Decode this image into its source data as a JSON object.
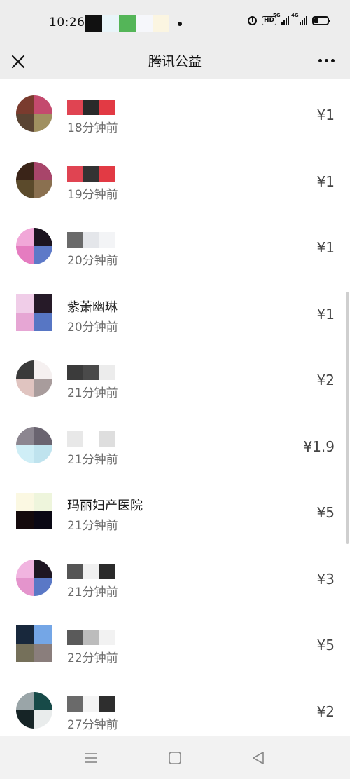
{
  "status_bar": {
    "time": "10:26",
    "notification_colors": [
      "#111111",
      "#e9f5f9",
      "#54b558",
      "#f6f7fb",
      "#fbf5e1"
    ],
    "icons": [
      "alarm-icon",
      "hd-icon",
      "signal-5g-icon",
      "signal-4g-icon",
      "battery-icon"
    ],
    "hd_label": "HD",
    "sig1_label": "5G",
    "sig2_label": "4G"
  },
  "title_bar": {
    "title": "腾讯公益",
    "close_icon": "close-icon",
    "more_icon": "more-icon"
  },
  "donations": [
    {
      "name": "",
      "time": "18分钟前",
      "amount": "¥1",
      "avatar_round": true,
      "avatar": [
        "#7a3b2e",
        "#c44a6e",
        "#5a4433",
        "#a09060"
      ],
      "mosaic": [
        "#e04452",
        "#2a2a2a",
        "#e23a44"
      ]
    },
    {
      "name": "",
      "time": "19分钟前",
      "amount": "¥1",
      "avatar_round": true,
      "avatar": [
        "#3a2418",
        "#a8456a",
        "#5b4a2b",
        "#8a7050"
      ],
      "mosaic": [
        "#e04452",
        "#333333",
        "#e23a44"
      ]
    },
    {
      "name": "",
      "time": "20分钟前",
      "amount": "¥1",
      "avatar_round": true,
      "avatar": [
        "#f1a7d8",
        "#1c1420",
        "#e57cc0",
        "#5d79c8"
      ],
      "mosaic": [
        "#6a6a6a",
        "#e4e6ea",
        "#f3f4f6"
      ]
    },
    {
      "name": "紫萧幽琳",
      "time": "20分钟前",
      "amount": "¥1",
      "avatar_round": false,
      "avatar": [
        "#f0cde8",
        "#261a28",
        "#e6a6d4",
        "#5776c4"
      ],
      "mosaic": []
    },
    {
      "name": "",
      "time": "21分钟前",
      "amount": "¥2",
      "avatar_round": true,
      "avatar": [
        "#3a3a3a",
        "#f5f0f0",
        "#e0c4c0",
        "#a89c9c"
      ],
      "mosaic": [
        "#3b3b3b",
        "#4a4a4a",
        "#ececec"
      ]
    },
    {
      "name": "",
      "time": "21分钟前",
      "amount": "¥1.9",
      "avatar_round": true,
      "avatar": [
        "#8c8690",
        "#6a6470",
        "#cfeef6",
        "#bfe3ee"
      ],
      "mosaic": [
        "#e8e8e8",
        "#ffffff",
        "#dedede"
      ]
    },
    {
      "name": "玛丽妇产医院",
      "time": "21分钟前",
      "amount": "¥5",
      "avatar_round": false,
      "avatar": [
        "#fbf8e2",
        "#eef5dc",
        "#140a0c",
        "#0a0814"
      ],
      "mosaic": []
    },
    {
      "name": "",
      "time": "21分钟前",
      "amount": "¥3",
      "avatar_round": true,
      "avatar": [
        "#f1b4e0",
        "#1e1622",
        "#e494cc",
        "#5a78c6"
      ],
      "mosaic": [
        "#555555",
        "#f0f0f0",
        "#2b2b2b"
      ]
    },
    {
      "name": "",
      "time": "22分钟前",
      "amount": "¥5",
      "avatar_round": false,
      "avatar": [
        "#18283c",
        "#74a6e6",
        "#75705a",
        "#8a7e7c"
      ],
      "mosaic": [
        "#5a5a5a",
        "#bcbcbc",
        "#f2f2f2"
      ]
    },
    {
      "name": "",
      "time": "27分钟前",
      "amount": "¥2",
      "avatar_round": true,
      "avatar": [
        "#9aa5a8",
        "#174a48",
        "#162426",
        "#e9ecec"
      ],
      "mosaic": [
        "#6a6a6a",
        "#f4f4f4",
        "#2e2e2e"
      ]
    }
  ],
  "nav_bar": {
    "icons": [
      "menu-icon",
      "home-icon",
      "back-icon"
    ]
  }
}
